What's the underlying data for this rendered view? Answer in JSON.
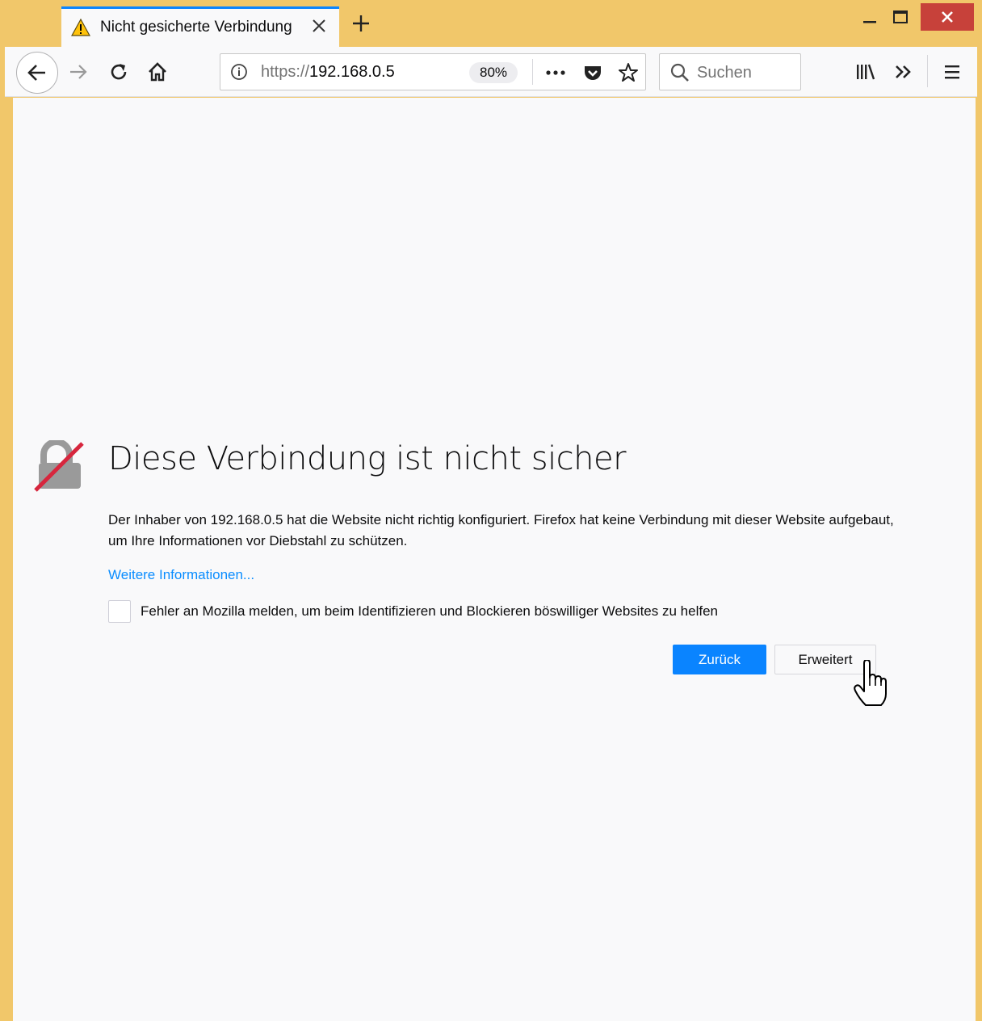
{
  "tab": {
    "title": "Nicht gesicherte Verbindung",
    "icon": "warning-icon"
  },
  "urlbar": {
    "scheme": "https://",
    "host": "192.168.0.5",
    "zoom": "80%"
  },
  "search": {
    "placeholder": "Suchen"
  },
  "error": {
    "title": "Diese Verbindung ist nicht sicher",
    "description": "Der Inhaber von 192.168.0.5 hat die Website nicht richtig konfiguriert. Firefox hat keine Verbindung mit dieser Website aufgebaut, um Ihre Informationen vor Diebstahl zu schützen.",
    "more_info": "Weitere Informationen...",
    "report_label": "Fehler an Mozilla melden, um beim Identifizieren und Blockieren böswilliger Websites zu helfen",
    "back_label": "Zurück",
    "advanced_label": "Erweitert"
  },
  "colors": {
    "frame": "#f1c76a",
    "accent": "#0a84ff",
    "close": "#c7413a",
    "link": "#0a8dff"
  }
}
